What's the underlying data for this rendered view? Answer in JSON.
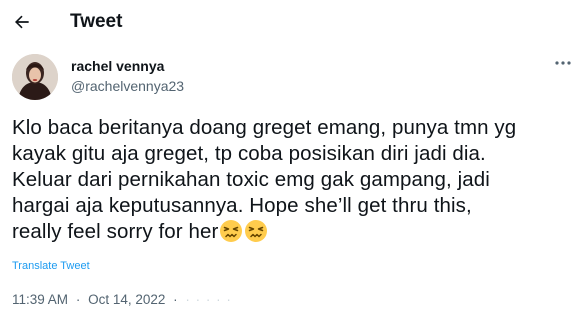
{
  "header": {
    "back_icon": "arrow-left-icon",
    "title": "Tweet"
  },
  "tweet": {
    "author_name": "rachel vennya",
    "author_handle": "@rachelvennya23",
    "more_icon": "more-dots-icon",
    "text": "Klo baca beritanya doang greget emang, punya tmn yg\nkayak gitu aja greget, tp coba posisikan diri jadi dia.\nKeluar dari pernikahan toxic emg gak gampang, jadi\nhargai aja keputusannya. Hope she’ll get thru this,\nreally feel sorry for her",
    "emojis": [
      "persevering-face-emoji",
      "persevering-face-emoji"
    ],
    "translate_label": "Translate Tweet",
    "time": "11:39 AM",
    "separator": "·",
    "date": "Oct 14, 2022",
    "trailing": "· · · · ·"
  },
  "colors": {
    "link": "#1d9bf0",
    "secondary": "#536471",
    "text": "#0f1419"
  }
}
